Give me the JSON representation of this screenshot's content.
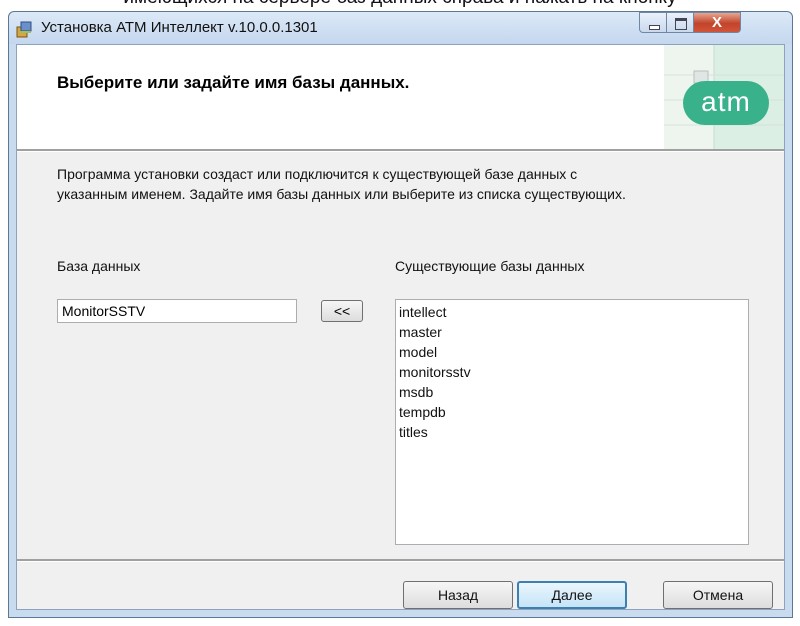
{
  "document": {
    "caption_fragment": "имеющихся на сервере баз данных справа и нажать на кнопку"
  },
  "window": {
    "title": "Установка АТМ Интеллект v.10.0.0.1301",
    "close_glyph": "X"
  },
  "banner": {
    "heading": "Выберите или задайте имя базы данных.",
    "logo_text": "atm"
  },
  "description": {
    "line1": "Программа установки создаст или подключится к существующей базе данных с",
    "line2": "указанным именем. Задайте имя базы данных или выберите из списка существующих."
  },
  "database": {
    "label": "База данных",
    "value": "MonitorSSTV"
  },
  "move_button": "<<",
  "existing": {
    "label": "Существующие базы данных",
    "items": [
      "intellect",
      "master",
      "model",
      "monitorsstv",
      "msdb",
      "tempdb",
      "titles"
    ]
  },
  "buttons": {
    "back": "Назад",
    "next": "Далее",
    "cancel": "Отмена"
  }
}
